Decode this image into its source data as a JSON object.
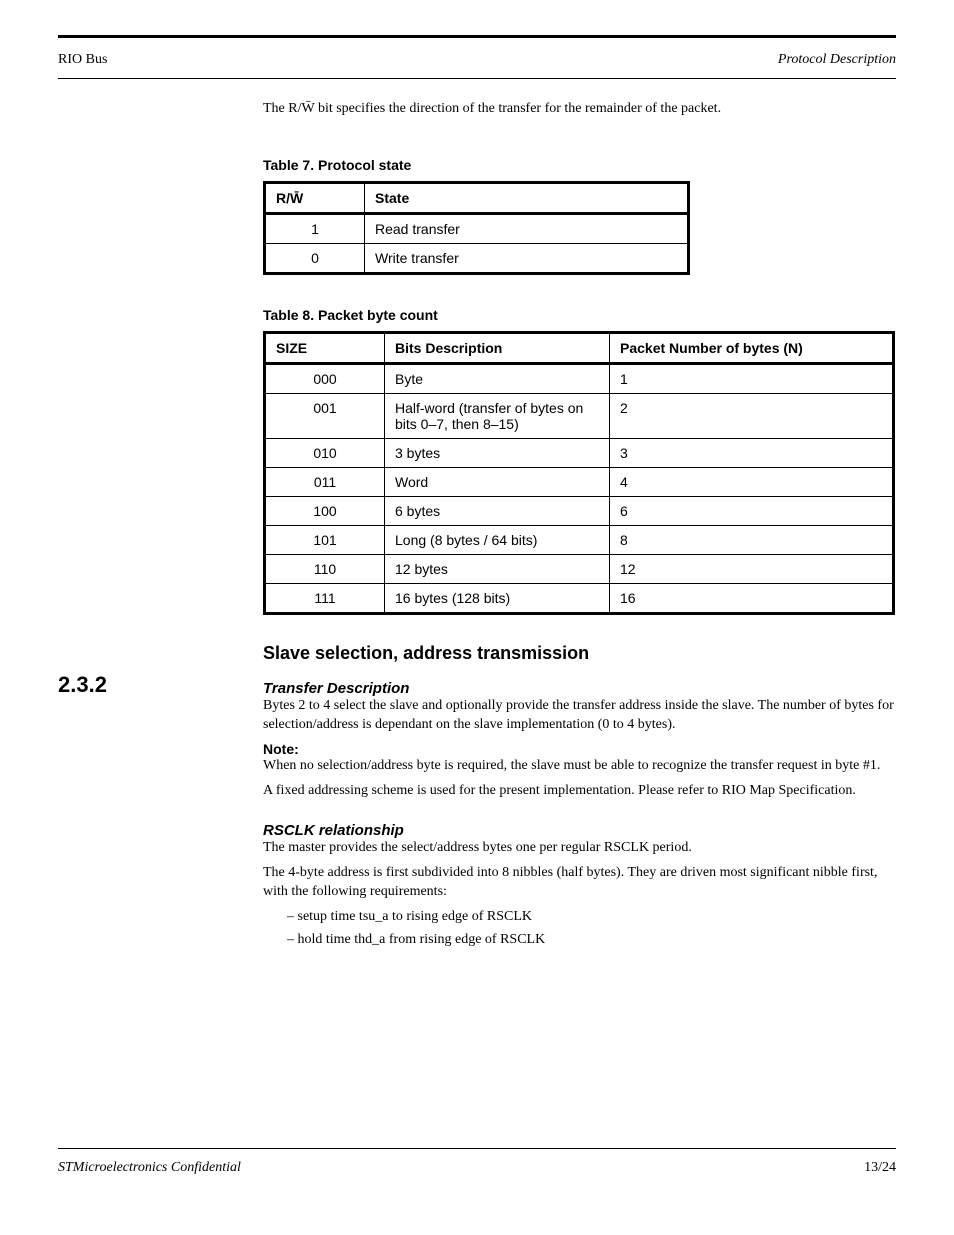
{
  "header": {
    "left": "RIO Bus",
    "right": "Protocol Description"
  },
  "intro": {
    "p1": "The R/W̄ bit specifies the direction of the transfer for the remainder of the packet.",
    "t1_caption": "Table 7. Protocol state",
    "t1_head": [
      "R/W̄",
      "State"
    ],
    "t1_rows": [
      [
        "1",
        "Read transfer"
      ],
      [
        "0",
        "Write transfer"
      ]
    ],
    "t2_caption": "Table 8. Packet byte count",
    "t2_head": [
      "SIZE",
      "Bits Description",
      "Packet Number of bytes (N)"
    ],
    "t2_rows": [
      [
        "000",
        "Byte",
        "1"
      ],
      [
        "001",
        "Half-word (transfer of bytes on bits 0–7, then 8–15)",
        "2"
      ],
      [
        "010",
        "3 bytes",
        "3"
      ],
      [
        "011",
        "Word",
        "4"
      ],
      [
        "100",
        "6 bytes",
        "6"
      ],
      [
        "101",
        "Long (8 bytes / 64 bits)",
        "8"
      ],
      [
        "110",
        "12 bytes",
        "12"
      ],
      [
        "111",
        "16 bytes (128 bits)",
        "16"
      ]
    ]
  },
  "sec": {
    "num": "2.3.2",
    "h": "Slave selection, address transmission",
    "sub1": "Transfer Description",
    "body1": "Bytes 2 to 4 select the slave and optionally provide the transfer address inside the slave. The number of bytes for selection/address is dependant on the slave implementation (0 to 4 bytes).",
    "noteh": "Note:",
    "notes": [
      "When no selection/address byte is required, the slave must be able to recognize the transfer request in byte #1.",
      "A fixed addressing scheme is used for the present implementation. Please refer to RIO Map Specification."
    ],
    "sub2": "RSCLK relationship",
    "body2a": "The master provides the select/address bytes one per regular RSCLK period.",
    "body2b": "The 4-byte address is first subdivided into 8 nibbles (half bytes). They are driven most significant nibble first, with the following requirements:",
    "bullets": [
      "setup time      tsu_a to rising edge of RSCLK",
      "hold time       thd_a from rising edge of RSCLK"
    ]
  },
  "footer": {
    "left": "STMicroelectronics Confidential",
    "right": "13/24"
  }
}
